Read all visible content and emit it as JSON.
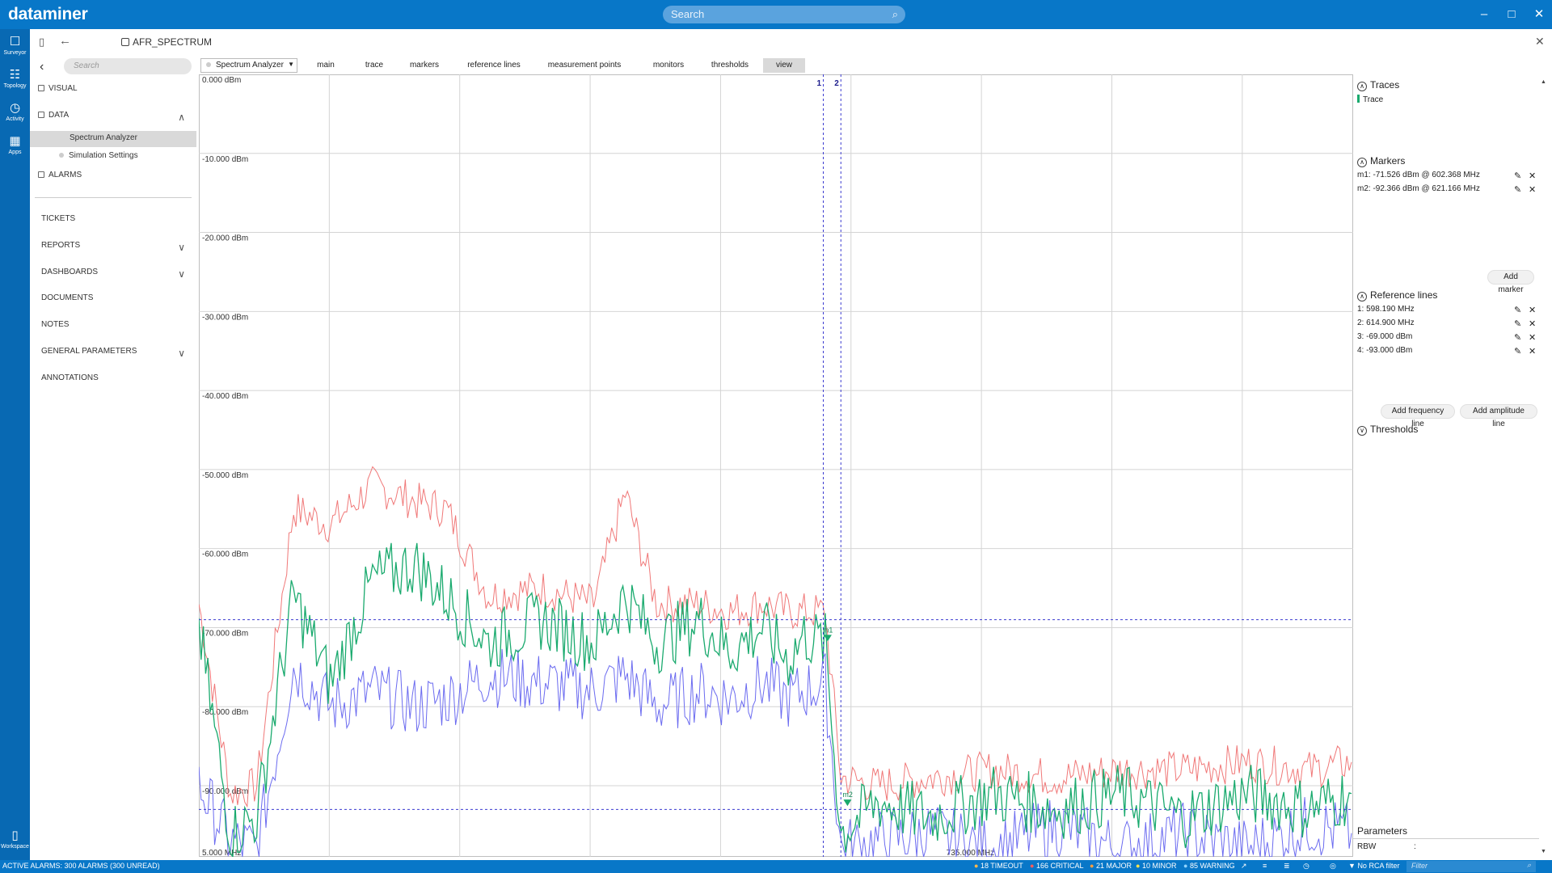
{
  "app": {
    "brand": "dataminer"
  },
  "global_search": {
    "placeholder": "Search"
  },
  "rail": [
    {
      "label": "Surveyor",
      "icon": "surveyor-icon"
    },
    {
      "label": "Topology",
      "icon": "topology-icon"
    },
    {
      "label": "Activity",
      "icon": "activity-icon"
    },
    {
      "label": "Apps",
      "icon": "apps-icon"
    },
    {
      "label": "Workspace",
      "icon": "workspace-icon"
    }
  ],
  "card": {
    "title": "AFR_SPECTRUM"
  },
  "nav": {
    "search_placeholder": "Search",
    "items": [
      {
        "label": "VISUAL"
      },
      {
        "label": "DATA"
      },
      {
        "label": "Spectrum Analyzer"
      },
      {
        "label": "Simulation Settings"
      },
      {
        "label": "ALARMS"
      },
      {
        "label": "TICKETS"
      },
      {
        "label": "REPORTS"
      },
      {
        "label": "DASHBOARDS"
      },
      {
        "label": "DOCUMENTS"
      },
      {
        "label": "NOTES"
      },
      {
        "label": "GENERAL PARAMETERS"
      },
      {
        "label": "ANNOTATIONS"
      }
    ]
  },
  "view_select": {
    "value": "Spectrum Analyzer"
  },
  "tabs": [
    {
      "label": "main"
    },
    {
      "label": "trace"
    },
    {
      "label": "markers"
    },
    {
      "label": "reference lines"
    },
    {
      "label": "measurement points"
    },
    {
      "label": "monitors"
    },
    {
      "label": "thresholds"
    },
    {
      "label": "view"
    }
  ],
  "chart_data": {
    "type": "line",
    "y_tick_labels": [
      "0.000 dBm",
      "-10.000 dBm",
      "-20.000 dBm",
      "-30.000 dBm",
      "-40.000 dBm",
      "-50.000 dBm",
      "-60.000 dBm",
      "-70.000 dBm",
      "-80.000 dBm",
      "-90.000 dBm"
    ],
    "x_tick_labels": [
      "5.000 MHz",
      "735.000 MHz"
    ],
    "ylim": [
      -99,
      0
    ],
    "xlim_mhz": [
      5,
      1100
    ],
    "grid": true,
    "series": [
      {
        "name": "Trace",
        "color": "#1aaa6e",
        "points": [
          [
            5,
            -70
          ],
          [
            35,
            -96
          ],
          [
            60,
            -94
          ],
          [
            95,
            -66
          ],
          [
            130,
            -77
          ],
          [
            170,
            -64
          ],
          [
            210,
            -62
          ],
          [
            240,
            -66
          ],
          [
            280,
            -72
          ],
          [
            330,
            -69
          ],
          [
            380,
            -72
          ],
          [
            410,
            -66
          ],
          [
            440,
            -72
          ],
          [
            480,
            -69
          ],
          [
            510,
            -73
          ],
          [
            540,
            -70
          ],
          [
            565,
            -74
          ],
          [
            580,
            -71
          ],
          [
            600,
            -72
          ],
          [
            615,
            -96
          ],
          [
            650,
            -92
          ],
          [
            700,
            -94
          ],
          [
            760,
            -91
          ],
          [
            820,
            -93
          ],
          [
            880,
            -91
          ],
          [
            940,
            -94
          ],
          [
            1000,
            -91
          ],
          [
            1060,
            -93
          ],
          [
            1100,
            -91
          ]
        ]
      },
      {
        "color": "#f07878",
        "points": [
          [
            5,
            -67
          ],
          [
            35,
            -91
          ],
          [
            60,
            -90
          ],
          [
            95,
            -55
          ],
          [
            130,
            -57
          ],
          [
            170,
            -52
          ],
          [
            210,
            -54
          ],
          [
            240,
            -55
          ],
          [
            280,
            -66
          ],
          [
            330,
            -65
          ],
          [
            380,
            -67
          ],
          [
            410,
            -53
          ],
          [
            440,
            -67
          ],
          [
            480,
            -67
          ],
          [
            510,
            -68
          ],
          [
            540,
            -67
          ],
          [
            565,
            -68
          ],
          [
            580,
            -68
          ],
          [
            600,
            -68
          ],
          [
            615,
            -89
          ],
          [
            650,
            -90
          ],
          [
            700,
            -89
          ],
          [
            760,
            -88
          ],
          [
            820,
            -89
          ],
          [
            880,
            -88
          ],
          [
            940,
            -88
          ],
          [
            1000,
            -87
          ],
          [
            1060,
            -88
          ],
          [
            1100,
            -87
          ]
        ]
      },
      {
        "color": "#6b6bf0",
        "points": [
          [
            5,
            -90
          ],
          [
            35,
            -97
          ],
          [
            60,
            -98
          ],
          [
            95,
            -75
          ],
          [
            130,
            -80
          ],
          [
            170,
            -78
          ],
          [
            210,
            -80
          ],
          [
            240,
            -79
          ],
          [
            280,
            -76
          ],
          [
            330,
            -77
          ],
          [
            380,
            -78
          ],
          [
            410,
            -76
          ],
          [
            440,
            -80
          ],
          [
            480,
            -78
          ],
          [
            510,
            -79
          ],
          [
            540,
            -77
          ],
          [
            565,
            -79
          ],
          [
            580,
            -78
          ],
          [
            600,
            -77
          ],
          [
            615,
            -98
          ],
          [
            650,
            -97
          ],
          [
            700,
            -96
          ],
          [
            760,
            -98
          ],
          [
            820,
            -95
          ],
          [
            880,
            -98
          ],
          [
            940,
            -96
          ],
          [
            1000,
            -98
          ],
          [
            1060,
            -95
          ],
          [
            1100,
            -96
          ]
        ]
      }
    ],
    "reference_lines": [
      {
        "id": "1",
        "axis": "x",
        "value_mhz": 598.19
      },
      {
        "id": "2",
        "axis": "x",
        "value_mhz": 614.9
      },
      {
        "id": "3",
        "axis": "y",
        "value_dbm": -69.0
      },
      {
        "id": "4",
        "axis": "y",
        "value_dbm": -93.0
      }
    ],
    "markers": [
      {
        "id": "m1",
        "freq_mhz": 602.368,
        "level_dbm": -71.526
      },
      {
        "id": "m2",
        "freq_mhz": 621.166,
        "level_dbm": -92.366
      }
    ]
  },
  "right_pane": {
    "traces_title": "Traces",
    "trace_name": "Trace",
    "markers_title": "Markers",
    "markers": [
      {
        "text": "m1: -71.526 dBm @ 602.368 MHz"
      },
      {
        "text": "m2: -92.366 dBm @ 621.166 MHz"
      }
    ],
    "add_marker": "Add marker",
    "reflines_title": "Reference lines",
    "reflines": [
      {
        "text": "1: 598.190 MHz"
      },
      {
        "text": "2: 614.900 MHz"
      },
      {
        "text": "3: -69.000 dBm"
      },
      {
        "text": "4: -93.000 dBm"
      }
    ],
    "add_freq_line": "Add frequency line",
    "add_amp_line": "Add amplitude line",
    "thresholds_title": "Thresholds",
    "parameters_title": "Parameters",
    "rbw_label": "RBW",
    "rbw_value": ":"
  },
  "status": {
    "active_alarms": "ACTIVE ALARMS: 300 ALARMS (300 UNREAD)",
    "timeout": "18 TIMEOUT",
    "critical": "166 CRITICAL",
    "major": "21 MAJOR",
    "minor": "10 MINOR",
    "warning": "85 WARNING",
    "rca": "No RCA filter",
    "filter_placeholder": "Filter"
  },
  "colors": {
    "brand_blue": "#0877c8",
    "rail_blue": "#0869b3",
    "trace_green": "#1aaa6e",
    "max_hold_red": "#f07878",
    "min_hold_blue": "#6b6bf0",
    "ref_line": "#3b3bd0"
  }
}
